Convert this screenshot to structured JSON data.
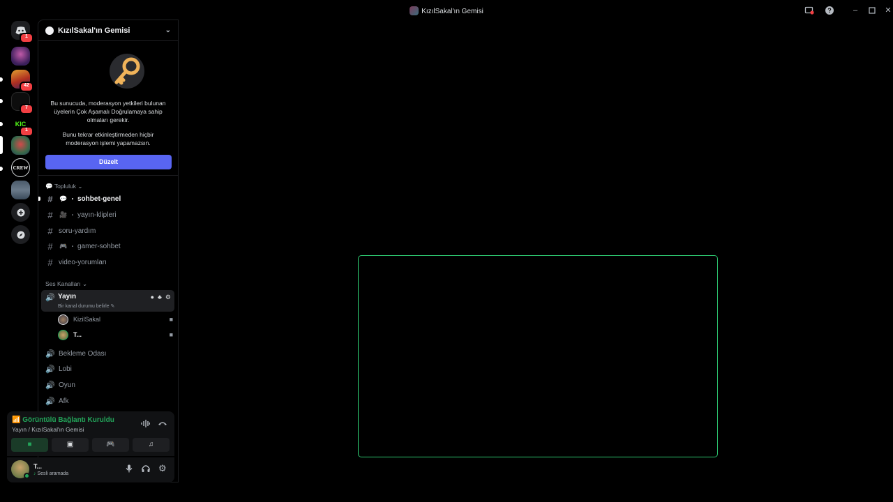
{
  "window": {
    "title": "KızılSakal'ın Gemisi",
    "controls": [
      "minimize-icon",
      "maximize-icon",
      "close-icon"
    ],
    "tools": [
      "inbox-icon",
      "help-icon"
    ]
  },
  "guilds": {
    "items": [
      {
        "name": "direct-messages",
        "badge": "1"
      },
      {
        "name": "server-1",
        "badge": ""
      },
      {
        "name": "server-2",
        "badge": "42"
      },
      {
        "name": "server-3",
        "badge": "7"
      },
      {
        "name": "server-kick",
        "badge": "1"
      },
      {
        "name": "server-active",
        "badge": ""
      },
      {
        "name": "server-crew",
        "badge": ""
      },
      {
        "name": "server-8",
        "badge": ""
      }
    ],
    "add_server": "add-server-icon",
    "discover": "compass-icon"
  },
  "server": {
    "name": "KızılSakal'ın Gemisi"
  },
  "mfa_notice": {
    "text1": "Bu sunucuda, moderasyon yetkileri bulunan üyelerin Çok Aşamalı Doğrulamaya sahip olmaları gerekir.",
    "text2": "Bunu tekrar etkinleştirmeden hiçbir moderasyon işlemi yapamazsın.",
    "button": "Düzelt"
  },
  "categories": {
    "community": "Topluluk",
    "voice": "Ses Kanalları"
  },
  "text_channels": [
    {
      "label": "sohbet-genel",
      "emoji": "💬",
      "sep": "・"
    },
    {
      "label": "yayın-klipleri",
      "emoji": "🎥",
      "sep": "・"
    },
    {
      "label": "soru-yardım",
      "emoji": "",
      "sep": ""
    },
    {
      "label": "gamer-sohbet",
      "emoji": "🎮",
      "sep": "・"
    },
    {
      "label": "video-yorumları",
      "emoji": "",
      "sep": ""
    }
  ],
  "voice_active": {
    "name": "Yayın",
    "status": "Bir kanal durumu belirle",
    "users": [
      {
        "name": "KizilSakal"
      },
      {
        "name": "T..."
      }
    ]
  },
  "voice_channels": [
    "Bekleme Odası",
    "Lobi",
    "Oyun",
    "Afk"
  ],
  "rtc": {
    "status": "Görüntülü Bağlantı Kuruldu",
    "where": "Yayın / KızılSakal'ın Gemisi"
  },
  "user": {
    "name": "T...",
    "status": "Sesli aramada"
  },
  "colors": {
    "accent": "#5865f2",
    "connected": "#23a55a",
    "stage_border": "#2dc770"
  }
}
